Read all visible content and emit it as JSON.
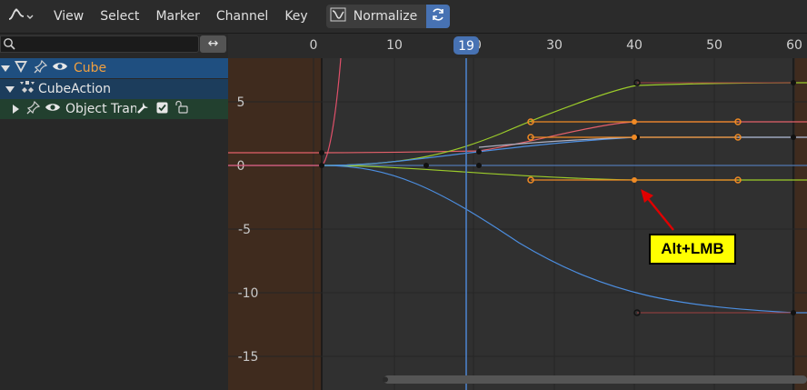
{
  "header": {
    "editor_type_icon": "graph-editor-icon",
    "menus": [
      "View",
      "Select",
      "Marker",
      "Channel",
      "Key"
    ],
    "normalize_label": "Normalize",
    "normalize_icon": "normalize-curve-icon",
    "sync_icon": "refresh-icon"
  },
  "channels": {
    "search_placeholder": "",
    "swap_icon": "↔",
    "object_name": "Cube",
    "action_name": "CubeAction",
    "group_name": "Object Transf"
  },
  "graph": {
    "frame_ticks": [
      "0",
      "10",
      "20",
      "30",
      "40",
      "50",
      "60"
    ],
    "current_frame": "19",
    "value_ticks": [
      "5",
      "0",
      "-5",
      "-10",
      "-15"
    ]
  },
  "annotation": {
    "text": "Alt+LMB"
  },
  "colors": {
    "selected_keyframe": "#f08a24",
    "playhead": "#4772b3",
    "callout_bg": "#ffff00",
    "arrow": "#e00000"
  }
}
